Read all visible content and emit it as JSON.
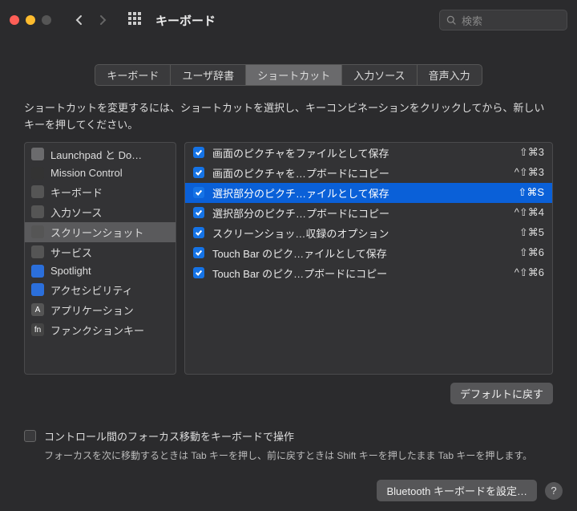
{
  "window": {
    "title": "キーボード",
    "search_placeholder": "検索"
  },
  "tabs": [
    {
      "label": "キーボード",
      "active": false
    },
    {
      "label": "ユーザ辞書",
      "active": false
    },
    {
      "label": "ショートカット",
      "active": true
    },
    {
      "label": "入力ソース",
      "active": false
    },
    {
      "label": "音声入力",
      "active": false
    }
  ],
  "help_text": "ショートカットを変更するには、ショートカットを選択し、キーコンビネーションをクリックしてから、新しいキーを押してください。",
  "categories": [
    {
      "icon_bg": "#6b6b6d",
      "icon_txt": "",
      "label": "Launchpad と Do…",
      "selected": false
    },
    {
      "icon_bg": "#333",
      "icon_txt": "",
      "label": "Mission Control",
      "selected": false
    },
    {
      "icon_bg": "#555",
      "icon_txt": "",
      "label": "キーボード",
      "selected": false
    },
    {
      "icon_bg": "#555",
      "icon_txt": "",
      "label": "入力ソース",
      "selected": false
    },
    {
      "icon_bg": "#555",
      "icon_txt": "",
      "label": "スクリーンショット",
      "selected": true
    },
    {
      "icon_bg": "#555",
      "icon_txt": "",
      "label": "サービス",
      "selected": false
    },
    {
      "icon_bg": "#2b6fdb",
      "icon_txt": "",
      "label": "Spotlight",
      "selected": false
    },
    {
      "icon_bg": "#2b6fdb",
      "icon_txt": "",
      "label": "アクセシビリティ",
      "selected": false
    },
    {
      "icon_bg": "#555",
      "icon_txt": "A",
      "label": "アプリケーション",
      "selected": false
    },
    {
      "icon_bg": "#444",
      "icon_txt": "fn",
      "label": "ファンクションキー",
      "selected": false
    }
  ],
  "shortcuts": [
    {
      "checked": true,
      "label": "画面のピクチャをファイルとして保存",
      "key": "⇧⌘3",
      "selected": false
    },
    {
      "checked": true,
      "label": "画面のピクチャを…プボードにコピー",
      "key": "^⇧⌘3",
      "selected": false
    },
    {
      "checked": true,
      "label": "選択部分のピクチ…ァイルとして保存",
      "key": "⇧⌘S",
      "selected": true
    },
    {
      "checked": true,
      "label": "選択部分のピクチ…プボードにコピー",
      "key": "^⇧⌘4",
      "selected": false
    },
    {
      "checked": true,
      "label": "スクリーンショッ…収録のオプション",
      "key": "⇧⌘5",
      "selected": false
    },
    {
      "checked": true,
      "label": "Touch Bar のピク…ァイルとして保存",
      "key": "⇧⌘6",
      "selected": false
    },
    {
      "checked": true,
      "label": "Touch Bar のピク…プボードにコピー",
      "key": "^⇧⌘6",
      "selected": false
    }
  ],
  "restore_defaults": "デフォルトに戻す",
  "footer": {
    "checkbox_label": "コントロール間のフォーカス移動をキーボードで操作",
    "help": "フォーカスを次に移動するときは Tab キーを押し、前に戻すときは Shift キーを押したまま Tab キーを押します。"
  },
  "bottom": {
    "bluetooth": "Bluetooth キーボードを設定…",
    "help": "?"
  }
}
